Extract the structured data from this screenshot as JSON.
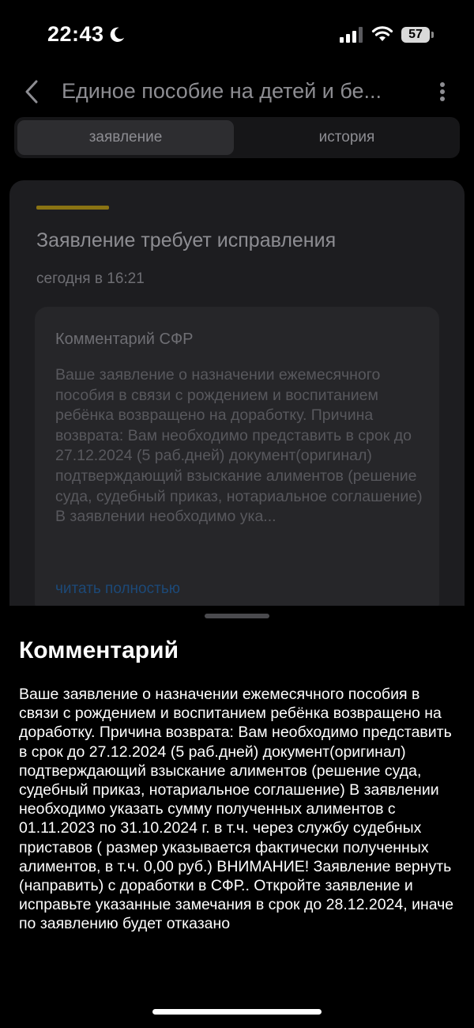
{
  "status_bar": {
    "time": "22:43",
    "battery": "57"
  },
  "header": {
    "title": "Единое пособие на детей и бе..."
  },
  "tabs": [
    {
      "label": "заявление",
      "active": true
    },
    {
      "label": "история",
      "active": false
    }
  ],
  "card": {
    "title": "Заявление требует исправления",
    "date": "сегодня в 16:21",
    "accent_color": "#8a7313",
    "comment": {
      "title": "Комментарий СФР",
      "text": "Ваше заявление о назначении ежемесячного пособия в связи с рождением и воспитанием ребёнка возвращено на доработку. Причина возврата: Вам необходимо представить в срок до 27.12.2024 (5 раб.дней) документ(оригинал) подтверждающий взыскание алиментов (решение суда, судебный приказ, нотариальное соглашение) В заявлении необходимо ука...",
      "read_more": "читать полностью"
    }
  },
  "sheet": {
    "title": "Комментарий",
    "text": "Ваше заявление о назначении ежемесячного пособия в связи с рождением и воспитанием ребёнка возвращено на доработку. Причина возврата: Вам необходимо представить в срок до 27.12.2024 (5 раб.дней) документ(оригинал) подтверждающий взыскание алиментов (решение суда, судебный приказ, нотариальное соглашение) В заявлении необходимо указать сумму полученных алиментов с 01.11.2023 по 31.10.2024 г. в т.ч. через службу судебных приставов ( размер указывается фактически полученных алиментов, в т.ч. 0,00 руб.) ВНИМАНИЕ! Заявление вернуть (направить) с доработки в СФР.. Откройте заявление и исправьте указанные замечания в срок до 28.12.2024, иначе по заявлению будет отказано"
  },
  "icons": {
    "back": "chevron-left-icon",
    "more": "more-vertical-icon",
    "moon": "moon-icon",
    "signal": "cellular-signal-icon",
    "wifi": "wifi-icon"
  }
}
